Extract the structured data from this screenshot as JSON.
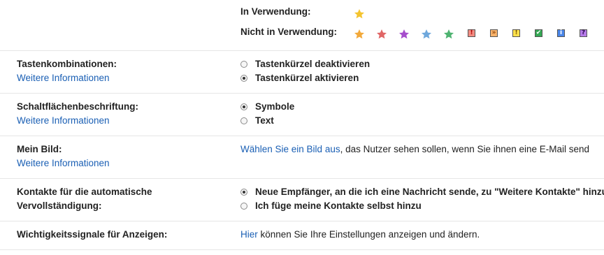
{
  "stars": {
    "in_use_label": "In Verwendung:",
    "not_in_use_label": "Nicht in Verwendung:",
    "in_use": [
      {
        "name": "yellow-star",
        "color": "#f4c430"
      }
    ],
    "not_in_use": [
      {
        "name": "orange-star",
        "color": "#f2a93b"
      },
      {
        "name": "red-star",
        "color": "#e06666"
      },
      {
        "name": "purple-star",
        "color": "#a64dcc"
      },
      {
        "name": "blue-star",
        "color": "#6fa8dc"
      },
      {
        "name": "green-star",
        "color": "#4fb371"
      }
    ],
    "badges": [
      {
        "name": "red-bang-icon",
        "glyph": "!",
        "bg": "#f28c82",
        "fg": "#b00000"
      },
      {
        "name": "orange-guillemet-icon",
        "glyph": "»",
        "bg": "#f6b26b",
        "fg": "#8a3b00"
      },
      {
        "name": "yellow-bang-icon",
        "glyph": "!",
        "bg": "#ffe14d",
        "fg": "#7a5b00"
      },
      {
        "name": "green-check-icon",
        "glyph": "✔",
        "bg": "#34a853",
        "fg": "#ffffff"
      },
      {
        "name": "blue-info-icon",
        "glyph": "i",
        "bg": "#4a86e8",
        "fg": "#ffffff"
      },
      {
        "name": "purple-question-icon",
        "glyph": "?",
        "bg": "#b57be8",
        "fg": "#2a0050"
      }
    ]
  },
  "shortcuts": {
    "title": "Tastenkombinationen:",
    "more": "Weitere Informationen",
    "opt_off": "Tastenkürzel deaktivieren",
    "opt_on": "Tastenkürzel aktivieren"
  },
  "button_labels": {
    "title": "Schaltflächenbeschriftung:",
    "more": "Weitere Informationen",
    "opt_icons": "Symbole",
    "opt_text": "Text"
  },
  "picture": {
    "title": "Mein Bild:",
    "more": "Weitere Informationen",
    "link": "Wählen Sie ein Bild aus",
    "rest": ", das Nutzer sehen sollen, wenn Sie ihnen eine E-Mail send"
  },
  "autocomplete": {
    "title_line1": "Kontakte für die automatische",
    "title_line2": "Vervollständigung:",
    "opt_auto": "Neue Empfänger, an die ich eine Nachricht sende, zu \"Weitere Kontakte\" hinzu",
    "opt_manual": "Ich füge meine Kontakte selbst hinzu"
  },
  "ads": {
    "title": "Wichtigkeitssignale für Anzeigen:",
    "link": "Hier",
    "rest": " können Sie Ihre Einstellungen anzeigen und ändern."
  }
}
